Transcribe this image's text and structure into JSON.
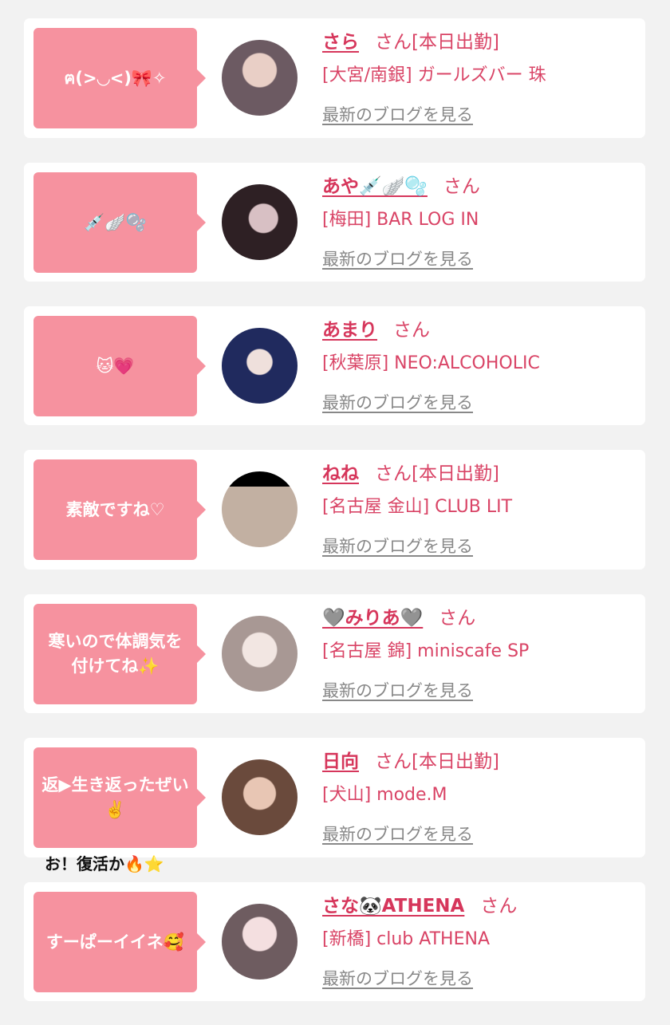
{
  "common": {
    "san": "さん",
    "blog_link": "最新のブログを見る"
  },
  "entries": [
    {
      "comment": "ฅ(>◡<)🎀✧",
      "name": "さら",
      "status": "[本日出勤]",
      "shop": "[大宮/南銀] ガールズバー 珠"
    },
    {
      "comment": "💉🪽🫧",
      "name": "あや💉🪽🫧",
      "status": "",
      "shop": "[梅田] BAR LOG IN"
    },
    {
      "comment": "🐱💗",
      "name": "あまり",
      "status": "",
      "shop": "[秋葉原] NEO:ALCOHOLIC"
    },
    {
      "comment": "素敵ですね♡",
      "name": "ねね",
      "status": "[本日出勤]",
      "shop": "[名古屋 金山] CLUB LIT"
    },
    {
      "comment": "寒いので体調気を付けてね✨",
      "name": "🩶みりあ🩶",
      "status": "",
      "shop": "[名古屋 錦] miniscafe SP"
    },
    {
      "comment": "返▶生き返ったぜい✌️",
      "name": "日向",
      "status": "[本日出勤]",
      "shop": "[犬山] mode.M"
    },
    {
      "comment": "すーぱーイイネ🥰",
      "name": "さな🐼ATHENA",
      "status": "",
      "shop": "[新橋] club ATHENA"
    }
  ],
  "overlay_note": "お！復活か🔥⭐",
  "avatar_colors": [
    "#8a7a82",
    "#3a2a2e",
    "#1c2a66",
    "#b8a89a",
    "#d8ccc8",
    "#c89a84",
    "#b4a2a8"
  ]
}
